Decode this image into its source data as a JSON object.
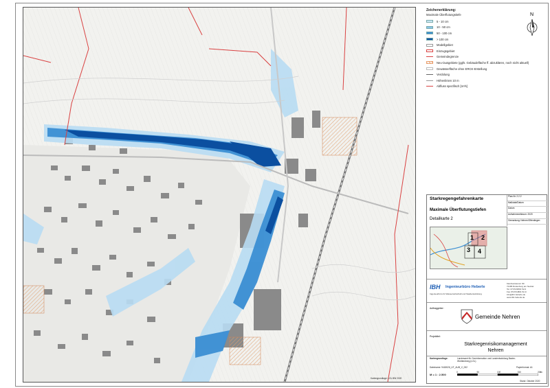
{
  "legend": {
    "title": "Zeichenerklärung:",
    "subtitle": "Maximale Überflutungstiefe",
    "items": [
      {
        "label": "5 - 10 cm",
        "color": "#cfe8f7",
        "kind": "fill"
      },
      {
        "label": "10 - 50 cm",
        "color": "#8cc4ea",
        "kind": "fill"
      },
      {
        "label": "50 - 100 cm",
        "color": "#3b8ed3",
        "kind": "fill"
      },
      {
        "label": "> 100 cm",
        "color": "#0b4fa0",
        "kind": "fill"
      },
      {
        "label": "Modellgebiet",
        "color": "#999999",
        "kind": "outline"
      },
      {
        "label": "Einzugsgebiet",
        "color": "#d94040",
        "kind": "outline-red"
      },
      {
        "label": "Gemeindegrenze",
        "color": "#d94040",
        "kind": "line"
      },
      {
        "label": "Neu-/ausgebiete (ggfs. Gebäudefläche ff. abzuklären, noch nicht aktuell)",
        "color": "#e8a070",
        "kind": "hatch"
      },
      {
        "label": "Gewässerfläche ohne ERCK-Erstellung",
        "color": "#bbbbbb",
        "kind": "outline"
      },
      {
        "label": "Verdolung",
        "color": "#666666",
        "kind": "line"
      },
      {
        "label": "Höhenlinien 10 m",
        "color": "#999999",
        "kind": "line"
      },
      {
        "label": "Abfluss spezifisch [m³/s]",
        "color": "#d94040",
        "kind": "line"
      }
    ]
  },
  "north": {
    "label": "N"
  },
  "title_block": {
    "title": "Starkregengefahrenkarte",
    "subtitle": "Maximale Überflutungstiefen",
    "detail": "Detailkarte 2",
    "meta": [
      "Plan-Nr. 2.2.2",
      "Maßstab/Datum",
      "Datum",
      "Aufnahmezeitraum: 2020",
      "Format",
      "Gemarkung: Nehren/Ofterdingen"
    ],
    "overview_numbers": [
      "1",
      "2",
      "3",
      "4"
    ],
    "firm_short": "IBH",
    "firm_name": "Ingenieurbüro Heberle",
    "firm_sub": "Ingenieurbüro für Wasserwirtschaft und Stadtentwicklung",
    "firm_addr": [
      "Kleinheindenstr. 80",
      "72186 Rottenburg am Neckar",
      "Tel. 07472/4801 52-0",
      "Fax 07472/4801 52-9",
      "info@ibh-heberle.de",
      "www.ibh-heberle.de"
    ],
    "client_label": "Auftraggeber:",
    "client": "Gemeinde Nehren",
    "project_label": "Projektitel:",
    "project_line1": "Starkregenrisikomanagement",
    "project_line2": "Nehren",
    "basis_label": "Kartengrundlage:",
    "basis_text": "Landesamt für Geoinformation und Landentwicklung Baden-Württemberg (LGL)",
    "file": "Dateiname: 9418026_UT_AUB_V_002",
    "paper": "Papierformat: A1",
    "scale": "M = 1 : 2.500",
    "scale_ticks": [
      "0",
      "50",
      "100",
      "150",
      "200"
    ],
    "scale_unit": "m",
    "date": "Stand: Oktober 2020"
  },
  "map": {
    "footer_note": "Kartengrundlage: LGL BW 2020"
  }
}
